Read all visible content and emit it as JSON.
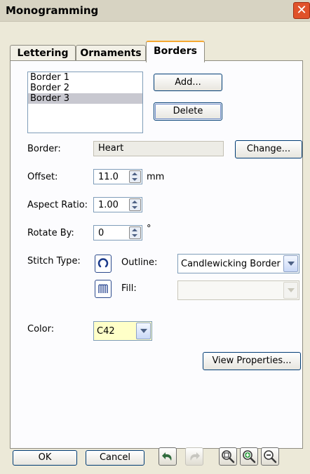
{
  "window": {
    "title": "Monogramming",
    "close_glyph": "✕"
  },
  "tabs": [
    {
      "label": "Lettering",
      "active": false
    },
    {
      "label": "Ornaments",
      "active": false
    },
    {
      "label": "Borders",
      "active": true
    }
  ],
  "borders_list": {
    "items": [
      "Border 1",
      "Border 2",
      "Border 3"
    ],
    "selected_index": 2
  },
  "buttons": {
    "add": "Add...",
    "delete": "Delete",
    "change": "Change...",
    "view_properties": "View Properties...",
    "ok": "OK",
    "cancel": "Cancel"
  },
  "fields": {
    "border": {
      "label": "Border:",
      "value": "Heart"
    },
    "offset": {
      "label": "Offset:",
      "value": "11.0",
      "unit": "mm"
    },
    "aspect_ratio": {
      "label": "Aspect Ratio:",
      "value": "1.00"
    },
    "rotate_by": {
      "label": "Rotate By:",
      "value": "0",
      "unit": "°"
    }
  },
  "stitch": {
    "label": "Stitch Type:",
    "outline_label": "Outline:",
    "outline_value": "Candlewicking Border",
    "fill_label": "Fill:",
    "fill_value": ""
  },
  "color": {
    "label": "Color:",
    "value": "C42",
    "swatch": "#ffffc8"
  },
  "icons": {
    "outline_stitch": "outline-stitch-icon",
    "fill_stitch": "fill-stitch-icon",
    "undo": "undo-icon",
    "redo": "redo-icon",
    "zoom_fit": "zoom-fit-icon",
    "zoom_in": "zoom-in-icon",
    "zoom_out": "zoom-out-icon"
  }
}
